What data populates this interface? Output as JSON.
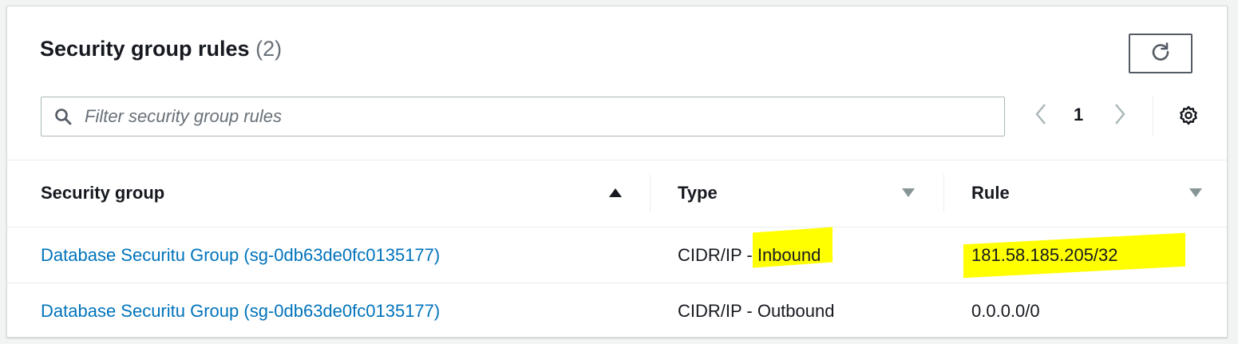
{
  "header": {
    "title": "Security group rules",
    "count": "(2)"
  },
  "filter": {
    "placeholder": "Filter security group rules",
    "value": ""
  },
  "pagination": {
    "current_page": "1"
  },
  "columns": [
    {
      "label": "Security group",
      "sort": "ascending"
    },
    {
      "label": "Type",
      "sort": "none"
    },
    {
      "label": "Rule",
      "sort": "none"
    }
  ],
  "rows": [
    {
      "security_group": "Database Securitu Group (sg-0db63de0fc0135177)",
      "type": "CIDR/IP - Inbound",
      "rule": "181.58.185.205/32"
    },
    {
      "security_group": "Database Securitu Group (sg-0db63de0fc0135177)",
      "type": "CIDR/IP - Outbound",
      "rule": "0.0.0.0/0"
    }
  ],
  "icons": {
    "refresh": "refresh-icon",
    "search": "search-icon",
    "prev": "chevron-left-icon",
    "next": "chevron-right-icon",
    "settings": "gear-icon"
  },
  "colors": {
    "link": "#0073bb",
    "highlight": "#ffff00",
    "text": "#16191f",
    "muted": "#687078"
  }
}
